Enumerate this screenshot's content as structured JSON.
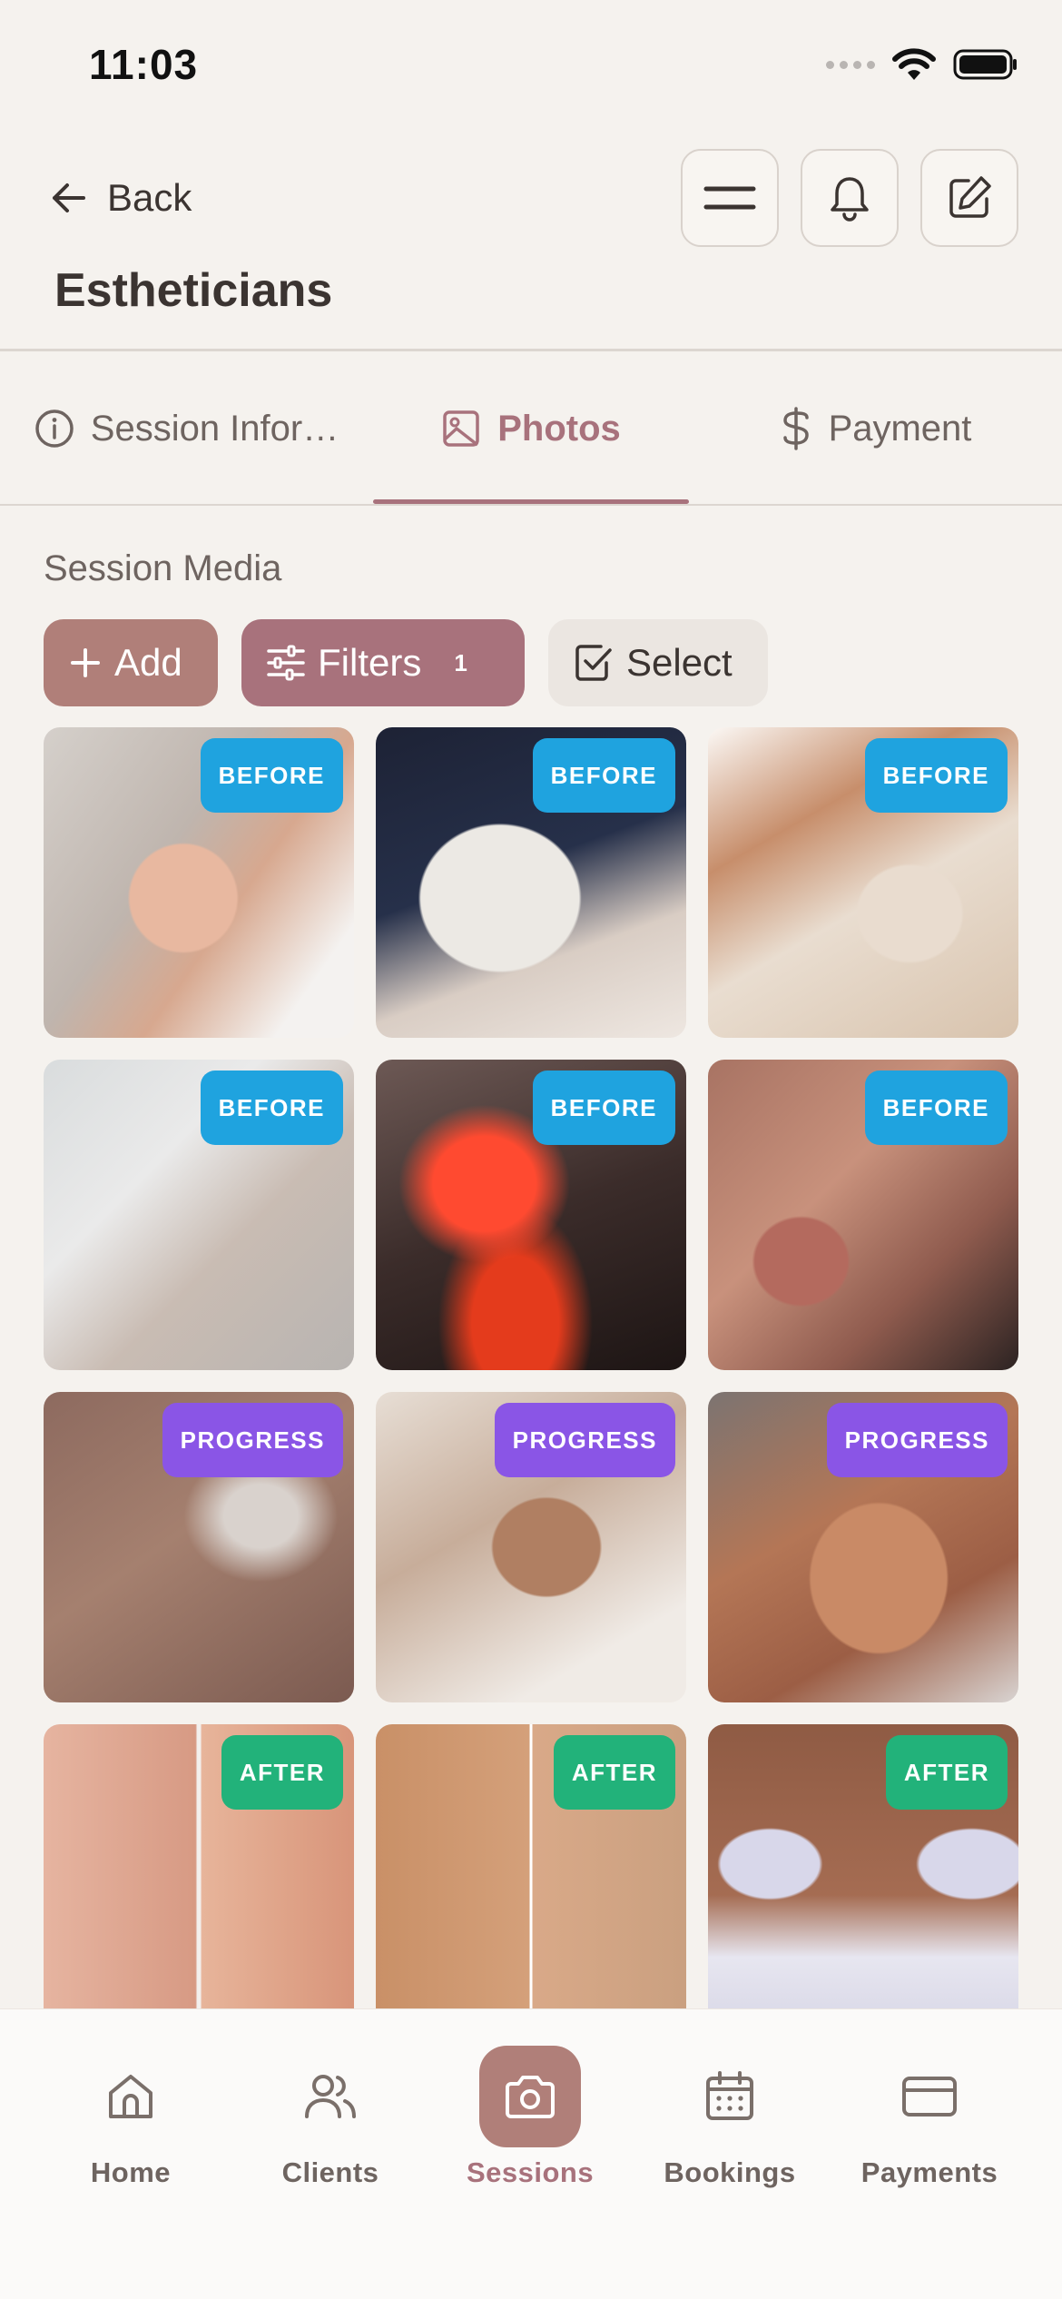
{
  "status_bar": {
    "time": "11:03"
  },
  "header": {
    "back_label": "Back",
    "title": "Estheticians",
    "actions": [
      "menu-icon",
      "bell-icon",
      "edit-icon"
    ]
  },
  "tabs": [
    {
      "label": "Session Infor…",
      "icon": "info-icon",
      "active": false
    },
    {
      "label": "Photos",
      "icon": "image-icon",
      "active": true
    },
    {
      "label": "Payment",
      "icon": "dollar-icon",
      "active": false
    }
  ],
  "media": {
    "section_label": "Session Media",
    "add_label": "Add",
    "filters_label": "Filters",
    "filters_count": "1",
    "select_label": "Select",
    "photos": [
      {
        "tag": "BEFORE"
      },
      {
        "tag": "BEFORE"
      },
      {
        "tag": "BEFORE"
      },
      {
        "tag": "BEFORE"
      },
      {
        "tag": "BEFORE"
      },
      {
        "tag": "BEFORE"
      },
      {
        "tag": "PROGRESS"
      },
      {
        "tag": "PROGRESS"
      },
      {
        "tag": "PROGRESS"
      },
      {
        "tag": "AFTER"
      },
      {
        "tag": "AFTER"
      },
      {
        "tag": "AFTER"
      }
    ]
  },
  "bottom_nav": [
    {
      "label": "Home",
      "icon": "home-icon",
      "active": false
    },
    {
      "label": "Clients",
      "icon": "users-icon",
      "active": false
    },
    {
      "label": "Sessions",
      "icon": "camera-icon",
      "active": true
    },
    {
      "label": "Bookings",
      "icon": "calendar-icon",
      "active": false
    },
    {
      "label": "Payments",
      "icon": "credit-card-icon",
      "active": false
    }
  ],
  "colors": {
    "accent": "#a8727c",
    "before_tag": "#1fa3df",
    "progress_tag": "#8a55e6",
    "after_tag": "#22b27a",
    "background": "#f5f2ee"
  }
}
